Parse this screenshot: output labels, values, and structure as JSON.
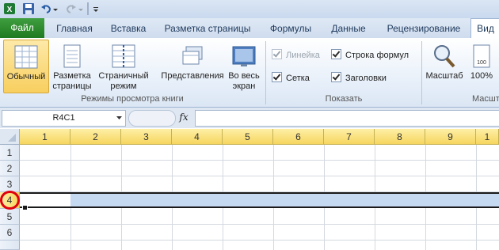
{
  "qat": {
    "icons": [
      "excel-logo-icon",
      "save-icon",
      "undo-icon",
      "redo-icon",
      "customize-qat-icon"
    ]
  },
  "tabs": {
    "file": "Файл",
    "items": [
      "Главная",
      "Вставка",
      "Разметка страницы",
      "Формулы",
      "Данные",
      "Рецензирование"
    ],
    "active": "Вид"
  },
  "ribbon": {
    "views_group": {
      "label": "Режимы просмотра книги",
      "buttons": [
        {
          "label": "Обычный"
        },
        {
          "label1": "Разметка",
          "label2": "страницы"
        },
        {
          "label1": "Страничный",
          "label2": "режим"
        },
        {
          "label": "Представления"
        },
        {
          "label1": "Во весь",
          "label2": "экран"
        }
      ]
    },
    "show_group": {
      "label": "Показать",
      "checkboxes": [
        {
          "label": "Линейка",
          "checked": true,
          "disabled": true
        },
        {
          "label": "Строка формул",
          "checked": true,
          "disabled": false
        },
        {
          "label": "Сетка",
          "checked": true,
          "disabled": false
        },
        {
          "label": "Заголовки",
          "checked": true,
          "disabled": false
        }
      ]
    },
    "zoom_group": {
      "label": "Масшт",
      "buttons": [
        {
          "label": "Масштаб"
        },
        {
          "label": "100%"
        }
      ]
    }
  },
  "formula_bar": {
    "name_box": "R4C1",
    "fx_label": "fx",
    "formula_value": ""
  },
  "sheet": {
    "columns": [
      "1",
      "2",
      "3",
      "4",
      "5",
      "6",
      "7",
      "8",
      "9",
      "1"
    ],
    "rows": [
      "1",
      "2",
      "3",
      "4",
      "5",
      "6"
    ],
    "selected_row": "4",
    "accent": "#e0000f",
    "selection_color": "#c5d9f1"
  }
}
